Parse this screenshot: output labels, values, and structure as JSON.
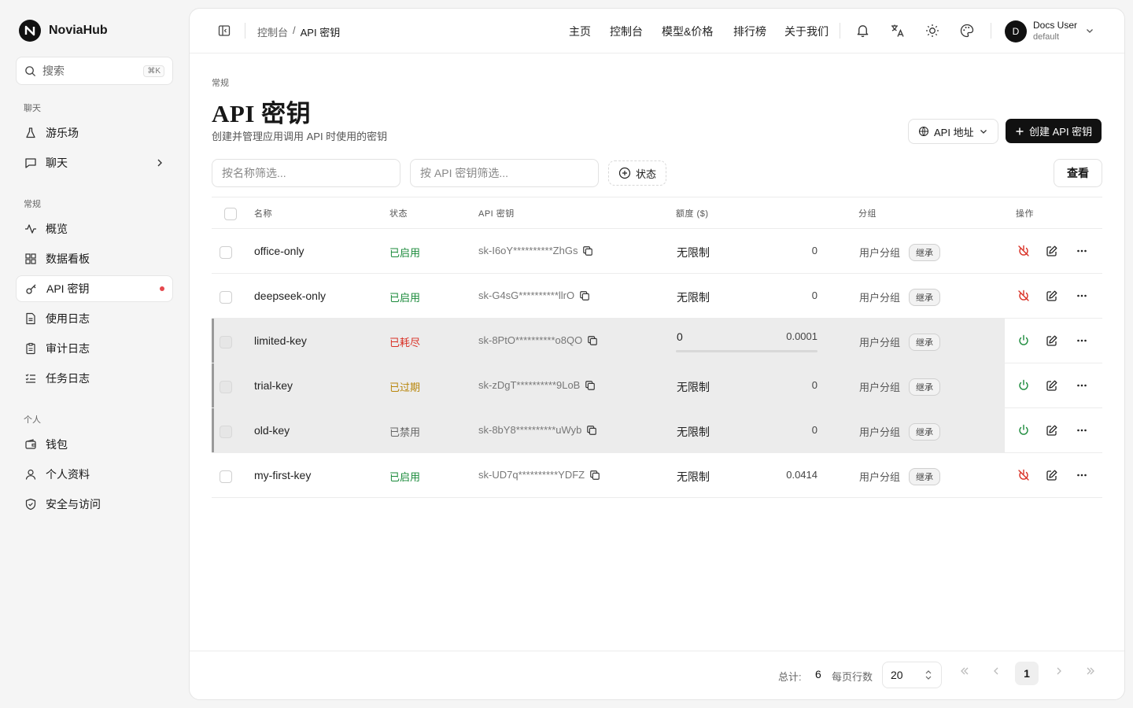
{
  "brand": {
    "name": "NoviaHub"
  },
  "search": {
    "label": "搜索",
    "shortcut": "⌘K"
  },
  "sidebar": {
    "groups": [
      {
        "label": "聊天"
      },
      {
        "label": "常规"
      },
      {
        "label": "个人"
      }
    ],
    "items": [
      {
        "label": "游乐场",
        "icon": "flask-icon"
      },
      {
        "label": "聊天",
        "icon": "message-square-icon"
      },
      {
        "label": "概览",
        "icon": "activity-icon"
      },
      {
        "label": "数据看板",
        "icon": "grid-icon"
      },
      {
        "label": "API 密钥",
        "icon": "key-icon",
        "active": true
      },
      {
        "label": "使用日志",
        "icon": "file-text-icon"
      },
      {
        "label": "审计日志",
        "icon": "clipboard-icon"
      },
      {
        "label": "任务日志",
        "icon": "list-checks-icon"
      },
      {
        "label": "钱包",
        "icon": "wallet-icon"
      },
      {
        "label": "个人资料",
        "icon": "user-icon"
      },
      {
        "label": "安全与访问",
        "icon": "shield-icon"
      }
    ]
  },
  "header": {
    "breadcrumb": {
      "parent": "控制台",
      "separator": "/",
      "current": "API 密钥"
    },
    "nav": [
      "主页",
      "控制台",
      "模型&价格",
      "排行榜",
      "关于我们"
    ],
    "user": {
      "initial": "D",
      "name": "Docs User",
      "group": "default"
    }
  },
  "page": {
    "section": "常规",
    "title": "API 密钥",
    "subtitle": "创建并管理应用调用 API 时使用的密钥",
    "api_address_label": "API 地址",
    "create_label": "创建 API 密钥",
    "filter_name_placeholder": "按名称筛选...",
    "filter_key_placeholder": "按 API 密钥筛选...",
    "status_filter_label": "状态",
    "view_label": "查看"
  },
  "table": {
    "columns": [
      "名称",
      "状态",
      "API 密钥",
      "额度 ($)",
      "分组",
      "操作"
    ],
    "rows": [
      {
        "name": "office-only",
        "status": "已启用",
        "status_kind": "ok",
        "key": "sk-I6oY**********ZhGs",
        "quota": "无限制",
        "used": "0",
        "group": "用户分组",
        "badge": "继承",
        "dim": false
      },
      {
        "name": "deepseek-only",
        "status": "已启用",
        "status_kind": "ok",
        "key": "sk-G4sG**********llrO",
        "quota": "无限制",
        "used": "0",
        "group": "用户分组",
        "badge": "继承",
        "dim": false
      },
      {
        "name": "limited-key",
        "status": "已耗尽",
        "status_kind": "red",
        "key": "sk-8PtO**********o8QO",
        "quota": "0",
        "used": "0.0001",
        "group": "用户分组",
        "badge": "继承",
        "dim": true,
        "bar": 1.0
      },
      {
        "name": "trial-key",
        "status": "已过期",
        "status_kind": "warn",
        "key": "sk-zDgT**********9LoB",
        "quota": "无限制",
        "used": "0",
        "group": "用户分组",
        "badge": "继承",
        "dim": true
      },
      {
        "name": "old-key",
        "status": "已禁用",
        "status_kind": "gray",
        "key": "sk-8bY8**********uWyb",
        "quota": "无限制",
        "used": "0",
        "group": "用户分组",
        "badge": "继承",
        "dim": true
      },
      {
        "name": "my-first-key",
        "status": "已启用",
        "status_kind": "ok",
        "key": "sk-UD7q**********YDFZ",
        "quota": "无限制",
        "used": "0.0414",
        "group": "用户分组",
        "badge": "继承",
        "dim": false
      }
    ]
  },
  "footer": {
    "total_label": "总计:",
    "total": "6",
    "rows_per_page_label": "每页行数",
    "page_size": "20",
    "current_page": "1"
  },
  "colors": {
    "ok": "#1a8a3a",
    "red": "#d93025",
    "warn": "#b8860b",
    "gray": "#666666",
    "accent": "#111111"
  }
}
